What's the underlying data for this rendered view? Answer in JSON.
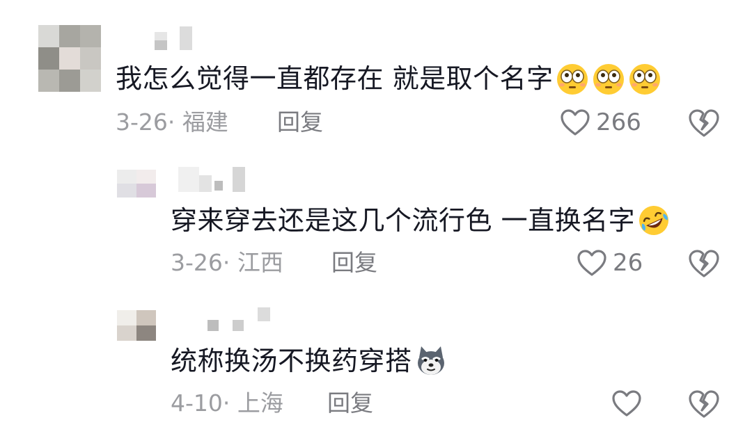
{
  "comments": [
    {
      "text": "我怎么觉得一直都存在 就是取个名字",
      "emojis": [
        "flushed-face-icon",
        "flushed-face-icon",
        "flushed-face-icon"
      ],
      "date": "3-26",
      "location": "福建",
      "reply_label": "回复",
      "likes": "266",
      "avatar_colors": [
        "#a7a7a0",
        "#c9c9c3",
        "#8e8e88",
        "#d8d6d3",
        "#b8b8b2"
      ]
    },
    {
      "text": "穿来穿去还是这几个流行色 一直换名字",
      "emojis": [
        "rolling-laughing-face-icon"
      ],
      "date": "3-26",
      "location": "江西",
      "reply_label": "回复",
      "likes": "26"
    },
    {
      "text": "统称换汤不换药穿搭",
      "emojis": [
        "doge-icon"
      ],
      "date": "4-10",
      "location": "上海",
      "reply_label": "回复",
      "likes": ""
    }
  ],
  "meta_separator": "· ",
  "colors": {
    "text": "#161823",
    "meta": "#9b9ca0",
    "action": "#7a7b80",
    "emoji_yellow": "#ffcc33"
  }
}
